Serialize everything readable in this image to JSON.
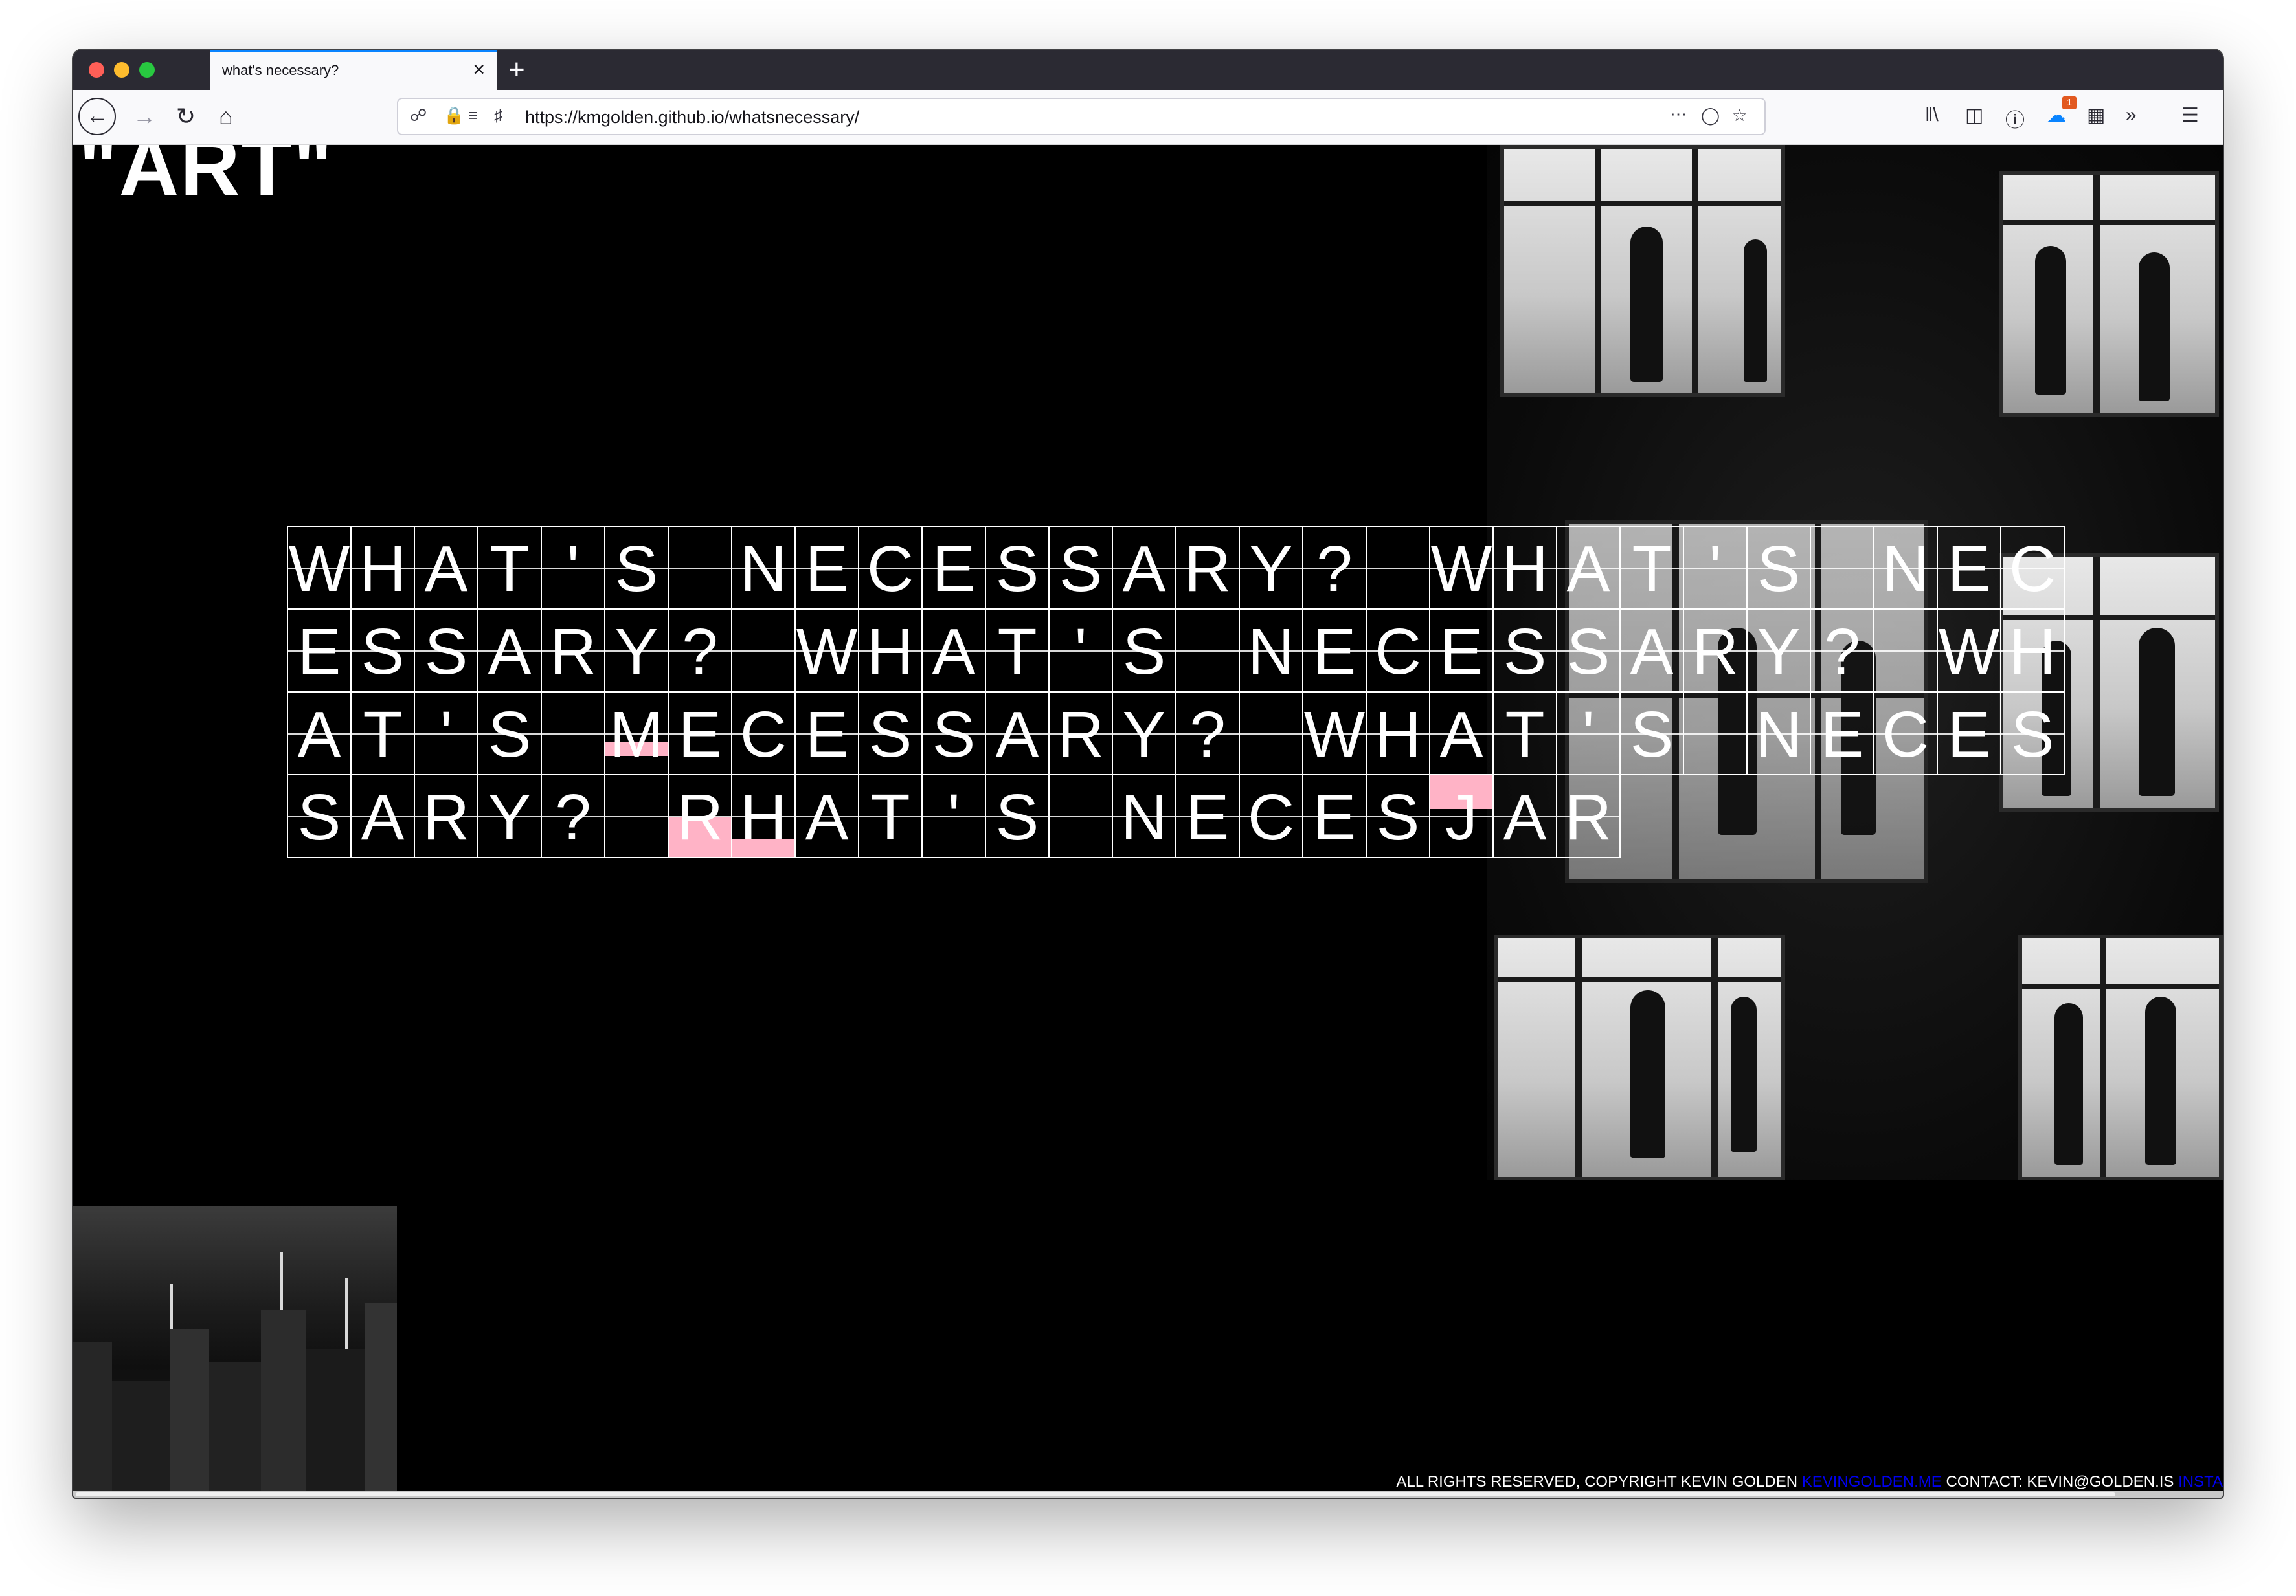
{
  "browser": {
    "tab_title": "what's necessary?",
    "url": "https://kmgolden.github.io/whatsnecessary/",
    "new_tab_symbol": "+",
    "close_symbol": "×",
    "addon_badge": "1"
  },
  "page": {
    "site_title": "\"ART\"",
    "grid_rows": [
      [
        "W",
        "H",
        "A",
        "T",
        "'",
        "S",
        " ",
        "N",
        "E",
        "C",
        "E",
        "S",
        "S",
        "A",
        "R",
        "Y",
        "?",
        " ",
        "W",
        "H",
        "A",
        "T",
        "'",
        "S",
        " ",
        "N"
      ],
      [
        "E",
        "C",
        "E",
        "S",
        "S",
        "A",
        "R",
        "Y",
        "?",
        " ",
        "W",
        "H",
        "A",
        "T",
        "'",
        "S",
        " ",
        "N",
        "E",
        "C",
        "E",
        "S",
        "S",
        "A",
        "R",
        "Y"
      ],
      [
        "?",
        " ",
        "W",
        "H",
        "A",
        "T",
        "'",
        "S",
        " ",
        "M",
        "E",
        "C",
        "E",
        "S",
        "S",
        "A",
        "R",
        "Y",
        "?",
        " ",
        "W",
        "H",
        "A",
        "T",
        "'",
        "S"
      ],
      [
        " ",
        "N",
        "E",
        "C",
        "E",
        "S",
        "S",
        "A",
        "R",
        "Y",
        "?",
        " ",
        "R",
        "H",
        "A",
        "T",
        "'",
        "S",
        " ",
        "N",
        "E",
        "C",
        "E",
        "S",
        "J",
        "A"
      ],
      [
        "R"
      ]
    ],
    "footer": {
      "text1": "ALL RIGHTS RESERVED, COPYRIGHT KEVIN GOLDEN ",
      "link1": "KEVINGOLDEN.ME",
      "text2": " CONTACT: KEVIN@GOLDEN.IS ",
      "link2": "INSTA"
    }
  },
  "colors": {
    "highlight": "#ffb3c6",
    "accent": "#0a84ff"
  }
}
